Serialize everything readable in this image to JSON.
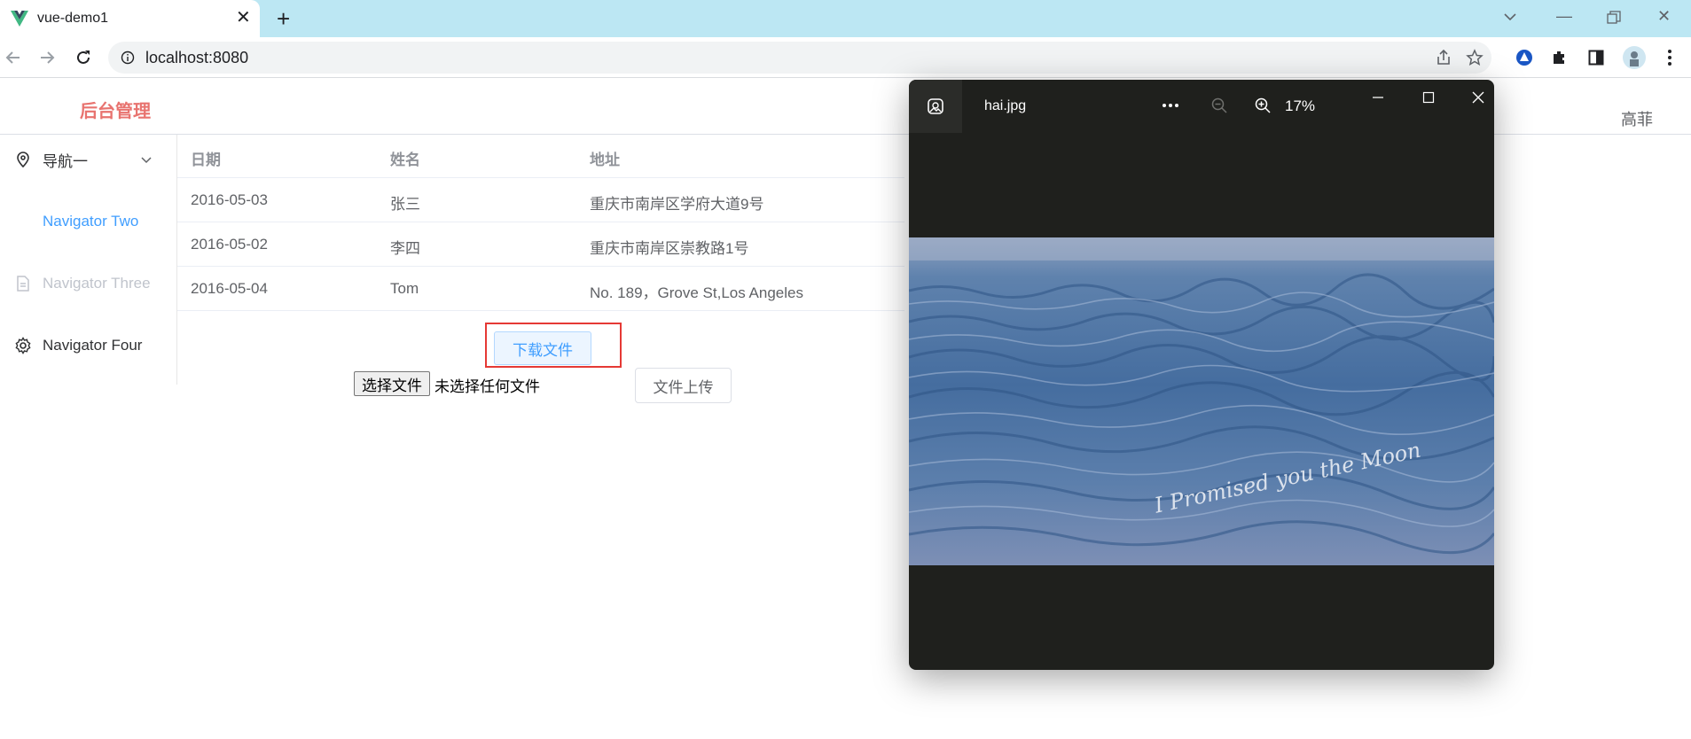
{
  "browser": {
    "tab_title": "vue-demo1",
    "url": "localhost:8080",
    "accent": "#bce7f3"
  },
  "app": {
    "logo": "后台管理",
    "user": "高菲",
    "menu": [
      {
        "label": "导航一",
        "icon": "location-icon",
        "active": false,
        "expandable": true
      },
      {
        "label": "Navigator Two",
        "icon": "none",
        "active": true
      },
      {
        "label": "Navigator Three",
        "icon": "document-icon",
        "disabled": true
      },
      {
        "label": "Navigator Four",
        "icon": "gear-icon",
        "active": false
      }
    ],
    "table": {
      "headers": [
        "日期",
        "姓名",
        "地址"
      ],
      "rows": [
        [
          "2016-05-03",
          "张三",
          "重庆市南岸区学府大道9号"
        ],
        [
          "2016-05-02",
          "李四",
          "重庆市南岸区崇教路1号"
        ],
        [
          "2016-05-04",
          "Tom",
          "No. 189，Grove St,Los Angeles"
        ]
      ]
    },
    "download_label": "下载文件",
    "file_choose_label": "选择文件",
    "file_none_label": "未选择任何文件",
    "upload_label": "文件上传"
  },
  "viewer": {
    "filename": "hai.jpg",
    "zoom": "17%",
    "image_caption": "I Promised you the Moon"
  }
}
